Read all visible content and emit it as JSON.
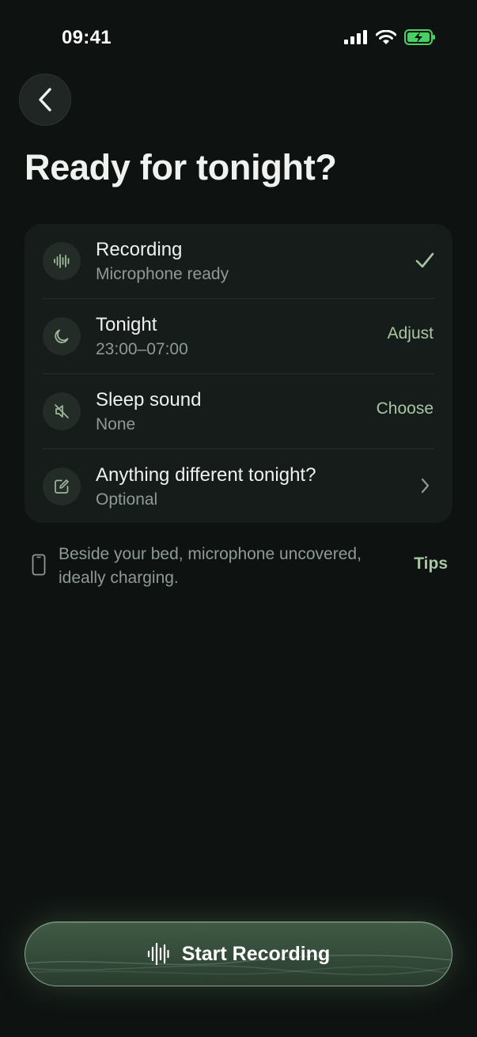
{
  "status": {
    "time": "09:41"
  },
  "title": "Ready for tonight?",
  "rows": [
    {
      "title": "Recording",
      "subtitle": "Microphone ready",
      "icon": "waveform-icon",
      "trailing": "checkmark-icon"
    },
    {
      "title": "Tonight",
      "subtitle": "23:00–07:00",
      "icon": "moon-icon",
      "action": "Adjust"
    },
    {
      "title": "Sleep sound",
      "subtitle": "None",
      "icon": "speaker-muted-icon",
      "action": "Choose"
    },
    {
      "title": "Anything different tonight?",
      "subtitle": "Optional",
      "icon": "edit-note-icon",
      "trailing": "chevron-right-icon"
    }
  ],
  "hint": {
    "text": "Beside your bed, microphone uncovered, ideally charging.",
    "link": "Tips"
  },
  "start_button": {
    "label": "Start Recording"
  },
  "colors": {
    "background": "#0e1311",
    "card": "#161c1a",
    "accent": "#a8c6a3",
    "battery": "#46d160"
  }
}
